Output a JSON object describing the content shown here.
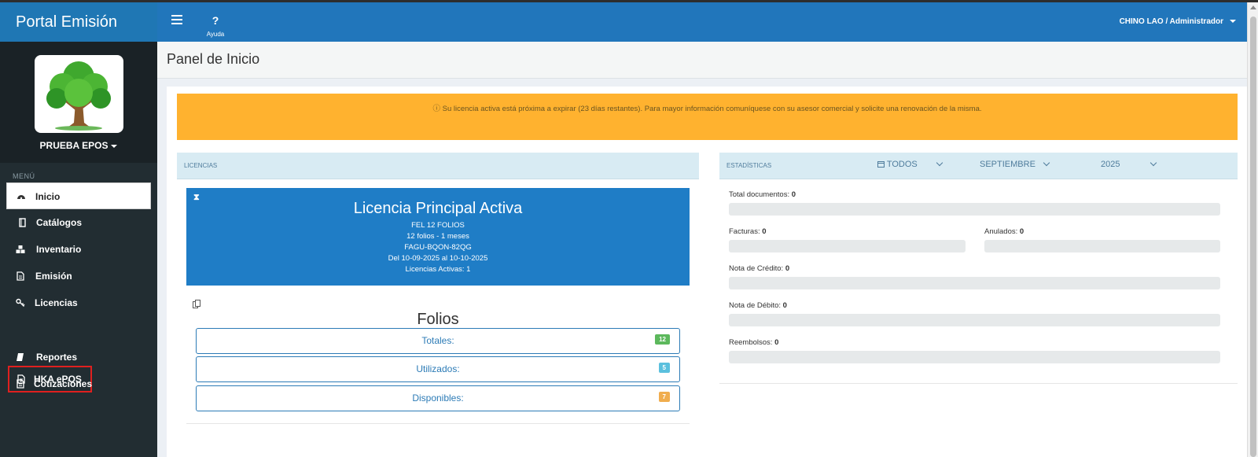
{
  "app": {
    "brand": "Portal Emisión"
  },
  "navbar": {
    "help_label": "Ayuda",
    "help_glyph": "?",
    "user": "CHINO LAO / Administrador"
  },
  "org": {
    "name": "PRUEBA EPOS"
  },
  "sidebar": {
    "menu_header": "MENÚ",
    "items": [
      {
        "label": "Inicio",
        "icon": "dashboard-icon"
      },
      {
        "label": "Catálogos",
        "icon": "book-icon"
      },
      {
        "label": "Inventario",
        "icon": "cubes-icon"
      },
      {
        "label": "Emisión",
        "icon": "document-icon"
      },
      {
        "label": "Licencias",
        "icon": "key-icon"
      },
      {
        "label": "HKA ePOS",
        "icon": "document-icon"
      },
      {
        "label": "Reportes",
        "icon": "book-icon"
      },
      {
        "label": "Cotizaciones",
        "icon": "document-icon"
      }
    ]
  },
  "page": {
    "title": "Panel de Inicio"
  },
  "alert": {
    "text": "ⓘ Su licencia activa está próxima a expirar (23 días restantes). Para mayor información comuníquese con su asesor comercial y solicite una renovación de la misma."
  },
  "licencias": {
    "header": "LICENCIAS",
    "card": {
      "title": "Licencia Principal Activa",
      "plan": "FEL 12 FOLIOS",
      "detail": "12 folios - 1 meses",
      "code": "FAGU-BQON-82QG",
      "period": "Del 10-09-2025 al 10-10-2025",
      "active": "Licencias Activas: 1"
    },
    "folios": {
      "title": "Folios",
      "rows": [
        {
          "label": "Totales:",
          "badge": "12"
        },
        {
          "label": "Utilizados:",
          "badge": "5"
        },
        {
          "label": "Disponibles:",
          "badge": "7"
        }
      ]
    }
  },
  "estadisticas": {
    "header": "ESTADÍSTICAS",
    "filter_type": "TODOS",
    "month": "SEPTIEMBRE",
    "year": "2025",
    "total": {
      "label": "Total documentos:",
      "value": "0"
    },
    "facturas": {
      "label": "Facturas:",
      "value": "0"
    },
    "anulados": {
      "label": "Anulados:",
      "value": "0"
    },
    "credito": {
      "label": "Nota de Crédito:",
      "value": "0"
    },
    "debito": {
      "label": "Nota de Débito:",
      "value": "0"
    },
    "reembolsos": {
      "label": "Reembolsos:",
      "value": "0"
    }
  },
  "colors": {
    "navbar": "#2176bb",
    "sidebar": "#222d32",
    "alert": "#ffb22f",
    "badge_total": "#5cb85c",
    "badge_used": "#5bc0de",
    "badge_avail": "#f0ad4e",
    "highlight": "#e0201f"
  }
}
